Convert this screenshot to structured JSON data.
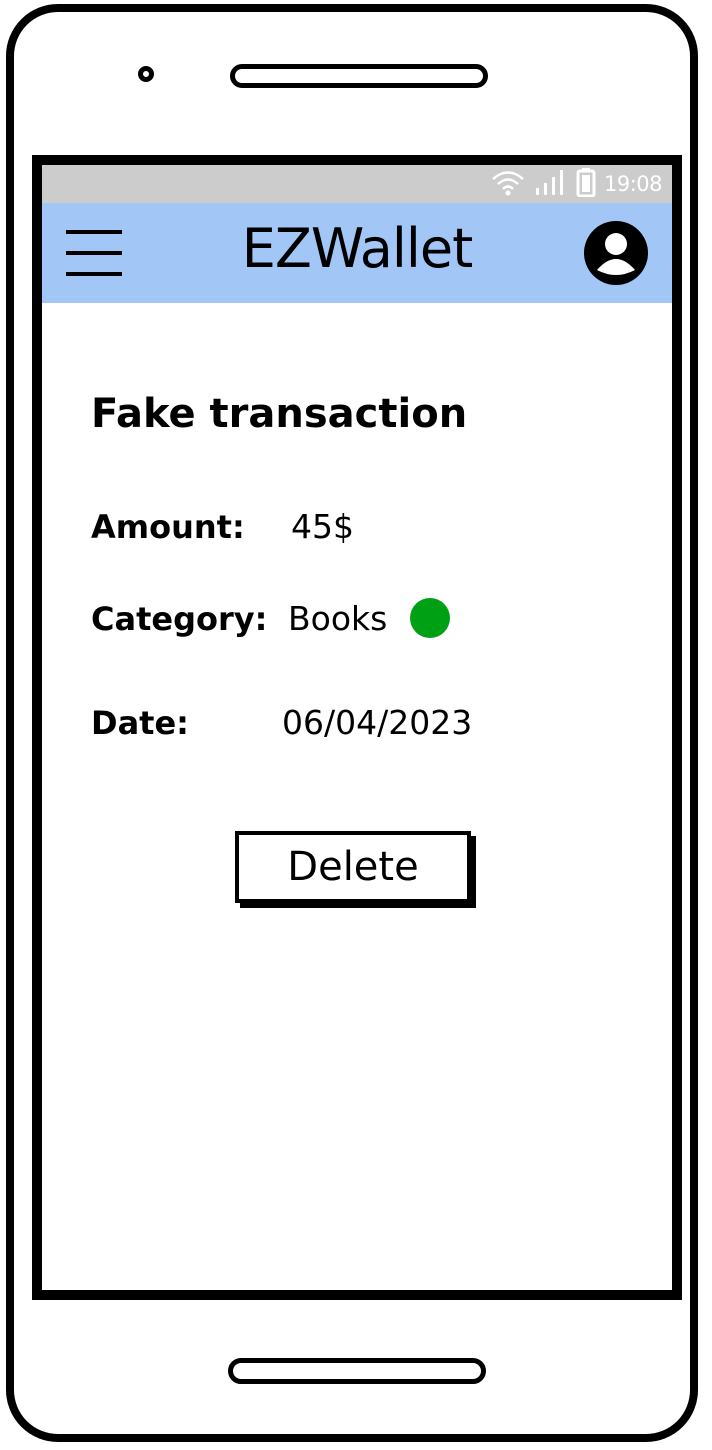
{
  "status_bar": {
    "time": "19:08",
    "icons": [
      "wifi-icon",
      "signal-icon",
      "battery-icon"
    ]
  },
  "app_bar": {
    "title": "EZWallet",
    "menu_icon": "hamburger-menu-icon",
    "profile_icon": "user-avatar-icon",
    "background": "#a2c6f6"
  },
  "transaction": {
    "title": "Fake transaction",
    "amount_label": "Amount:",
    "amount_value": "45$",
    "category_label": "Category:",
    "category_value": "Books",
    "category_color": "#00a014",
    "date_label": "Date:",
    "date_value": "06/04/2023"
  },
  "actions": {
    "delete_label": "Delete"
  }
}
